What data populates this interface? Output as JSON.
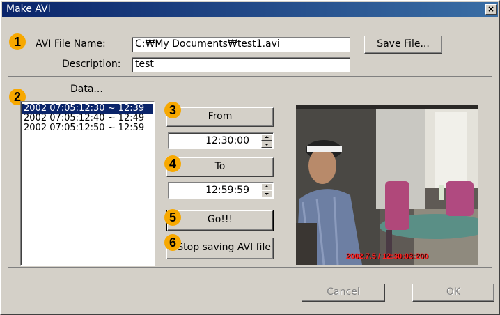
{
  "window": {
    "title": "Make AVI",
    "close_glyph": "×"
  },
  "form": {
    "file_name_label": "AVI File Name:",
    "file_name_value": "C:₩My Documents₩test1.avi",
    "save_button": "Save File...",
    "description_label": "Description:",
    "description_value": "test"
  },
  "data_list": {
    "label": "Data...",
    "items": [
      "2002 07:05:12:30 ~ 12:39",
      "2002 07:05:12:40 ~ 12:49",
      "2002 07:05:12:50 ~ 12:59"
    ],
    "selected_index": 0
  },
  "controls": {
    "from_button": "From",
    "from_time": "12:30:00",
    "to_button": "To",
    "to_time": "12:59:59",
    "go_button": "Go!!!",
    "stop_button": "Stop saving AVI file"
  },
  "preview": {
    "timestamp": "2002.7.5 / 12:30:03:200"
  },
  "footer": {
    "cancel_button": "Cancel",
    "ok_button": "OK"
  },
  "badges": [
    "1",
    "2",
    "3",
    "4",
    "5",
    "6"
  ],
  "colors": {
    "dialog_bg": "#d4d0c8",
    "titlebar": "#0a246a",
    "selection": "#0a246a",
    "badge": "#f7a800",
    "timestamp": "#ff2020"
  }
}
